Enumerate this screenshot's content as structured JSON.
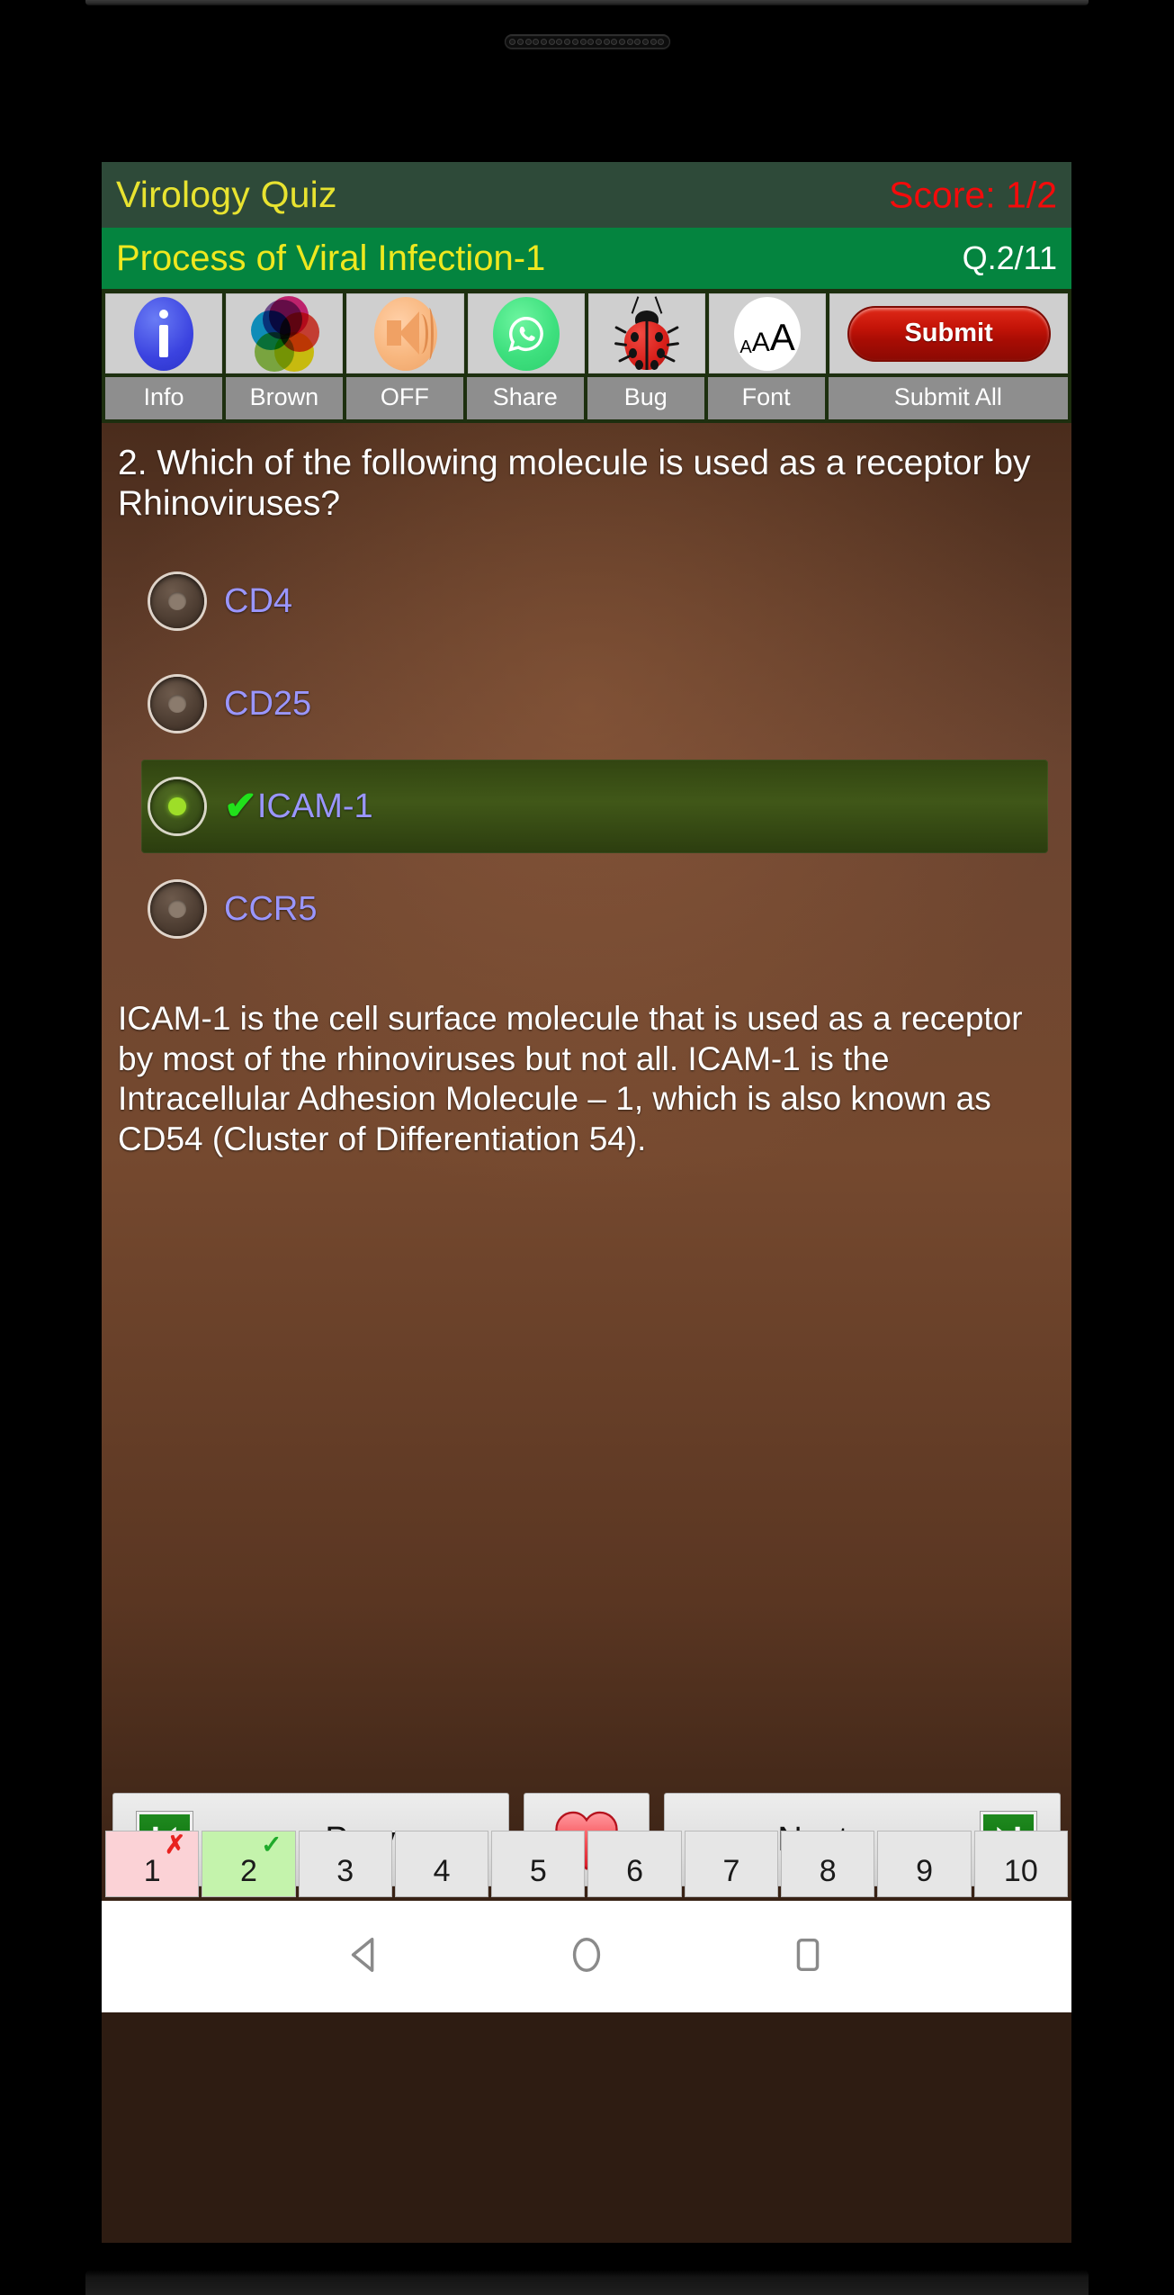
{
  "app": {
    "title": "Virology Quiz",
    "score": "Score: 1/2",
    "topic": "Process of Viral Infection-1",
    "question_counter": "Q.2/11"
  },
  "colors": {
    "title_bar_bg": "#2e4a39",
    "title_text": "#e8e330",
    "score_text": "#f40b0b",
    "subtitle_bar_bg": "#04843f",
    "subtitle_text": "#efe81f",
    "counter_text": "#ffffff",
    "toolbar_bg": "#1d2f0f",
    "toolbar_label_bg": "#8e8e8e",
    "body_bg": "#6b4430",
    "option_text": "#9a96ff",
    "correct_highlight_bg": "#3c5816",
    "correct_tick": "#21e21b",
    "submit_red": "#c41408",
    "pager_wrong_bg": "#fbd2d6",
    "pager_correct_bg": "#c4f3ac"
  },
  "toolbar": [
    {
      "icon": "info-icon",
      "label": "Info"
    },
    {
      "icon": "color-wheel-icon",
      "label": "Brown"
    },
    {
      "icon": "speaker-icon",
      "label": "OFF"
    },
    {
      "icon": "whatsapp-icon",
      "label": "Share"
    },
    {
      "icon": "ladybug-icon",
      "label": "Bug"
    },
    {
      "icon": "font-size-icon",
      "label": "Font"
    },
    {
      "icon": "submit-button",
      "label": "Submit All",
      "button_text": "Submit"
    }
  ],
  "quiz": {
    "question": "2. Which of the following molecule is used as a receptor by Rhinoviruses?",
    "options": [
      {
        "label": "CD4",
        "selected": false,
        "correct": false
      },
      {
        "label": "CD25",
        "selected": false,
        "correct": false
      },
      {
        "label": "ICAM-1",
        "selected": true,
        "correct": true,
        "tick": "✔"
      },
      {
        "label": "CCR5",
        "selected": false,
        "correct": false
      }
    ],
    "explanation": "ICAM-1 is the cell surface molecule that is used as a receptor by most of the rhinoviruses but not all. ICAM-1 is the Intracellular Adhesion Molecule – 1, which is also known as CD54 (Cluster of Differentiation 54)."
  },
  "nav": {
    "prev_label": "Prev",
    "next_label": "Next",
    "favorite_icon": "heart-icon"
  },
  "pager": [
    {
      "number": "1",
      "state": "wrong",
      "mark": "✗"
    },
    {
      "number": "2",
      "state": "correct",
      "mark": "✓"
    },
    {
      "number": "3",
      "state": "none",
      "mark": ""
    },
    {
      "number": "4",
      "state": "none",
      "mark": ""
    },
    {
      "number": "5",
      "state": "none",
      "mark": ""
    },
    {
      "number": "6",
      "state": "none",
      "mark": ""
    },
    {
      "number": "7",
      "state": "none",
      "mark": ""
    },
    {
      "number": "8",
      "state": "none",
      "mark": ""
    },
    {
      "number": "9",
      "state": "none",
      "mark": ""
    },
    {
      "number": "10",
      "state": "none",
      "mark": ""
    }
  ],
  "system_nav": [
    {
      "icon": "back-icon"
    },
    {
      "icon": "home-icon"
    },
    {
      "icon": "recents-icon"
    }
  ]
}
